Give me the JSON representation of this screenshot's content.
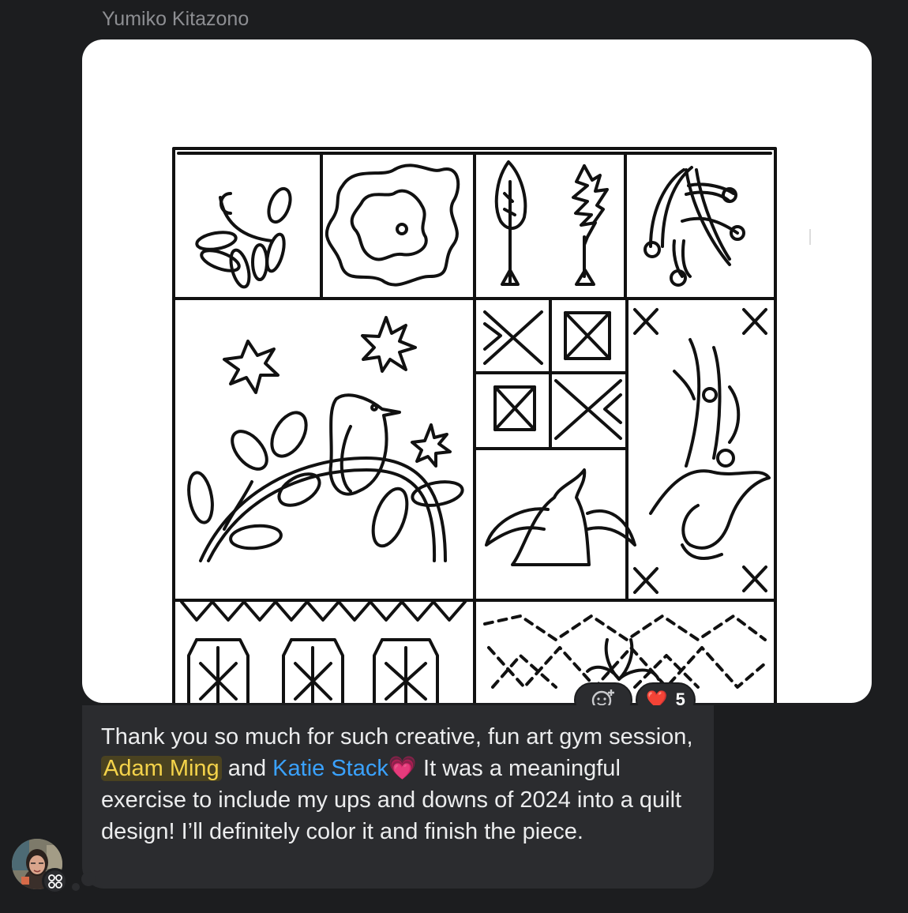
{
  "message": {
    "sender_name": "Yumiko Kitazono",
    "text_part1": "Thank you so much for such creative, fun art gym session, ",
    "mention1": "Adam Ming",
    "text_part2": " and ",
    "mention2": "Katie Stack",
    "emoji_after_mention": "💗",
    "text_part3": " It was a meaningful exercise to include my ups and downs of 2024 into a quilt design! I’ll definitely color it and finish the piece."
  },
  "reactions": {
    "heart_emoji": "❤️",
    "heart_count": "5"
  },
  "colors": {
    "background": "#1c1d1f",
    "bubble": "#2b2c2f",
    "mention_yellow": "#f4d34a",
    "mention_blue": "#3aa2ff"
  },
  "icons": {
    "add_reaction": "add-reaction-icon",
    "avatar_badge": "workplace-badge-icon"
  }
}
